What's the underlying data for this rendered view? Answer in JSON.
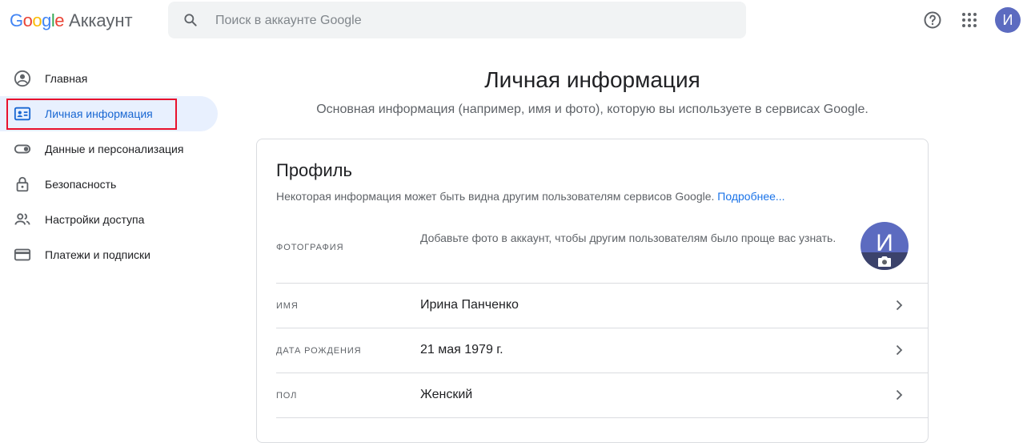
{
  "header": {
    "logo_google": "Google",
    "logo_product": "Аккаунт",
    "search_placeholder": "Поиск в аккаунте Google",
    "avatar_letter": "И",
    "icons": [
      "help-icon",
      "apps-grid-icon"
    ]
  },
  "sidebar": {
    "items": [
      {
        "label": "Главная",
        "icon": "home-account-icon"
      },
      {
        "label": "Личная информация",
        "icon": "id-card-icon",
        "active": true
      },
      {
        "label": "Данные и персонализация",
        "icon": "toggle-icon"
      },
      {
        "label": "Безопасность",
        "icon": "lock-icon"
      },
      {
        "label": "Настройки доступа",
        "icon": "people-icon"
      },
      {
        "label": "Платежи и подписки",
        "icon": "credit-card-icon"
      }
    ]
  },
  "main": {
    "title": "Личная информация",
    "subtitle": "Основная информация (например, имя и фото), которую вы используете в сервисах Google.",
    "profile": {
      "title": "Профиль",
      "description": "Некоторая информация может быть видна другим пользователям сервисов Google.",
      "more_link": "Подробнее...",
      "photo_label": "Фотография",
      "photo_text": "Добавьте фото в аккаунт, чтобы другим пользователям было проще вас узнать.",
      "avatar_letter": "И",
      "rows": [
        {
          "label": "Имя",
          "value": "Ирина Панченко"
        },
        {
          "label": "Дата рождения",
          "value": "21 мая 1979 г."
        },
        {
          "label": "Пол",
          "value": "Женский"
        }
      ]
    }
  },
  "colors": {
    "accent": "#1a73e8",
    "active_bg": "#e8f0fe",
    "avatar": "#5c6bc0",
    "highlight": "#e8112d"
  }
}
